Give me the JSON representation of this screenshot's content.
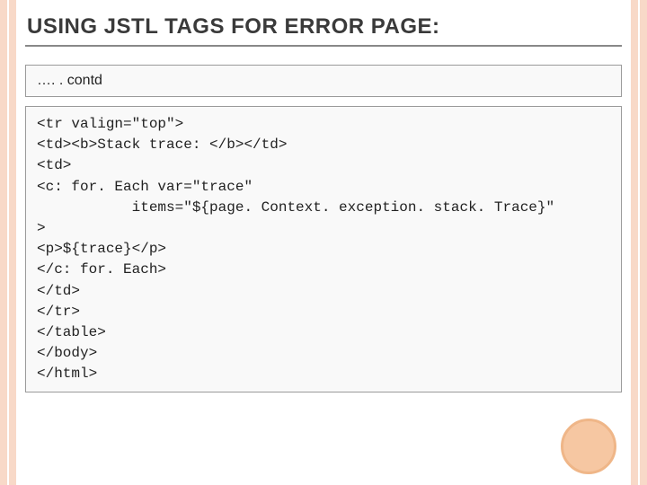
{
  "title": "USING JSTL TAGS FOR ERROR PAGE:",
  "contd_label": "…. . contd",
  "code_lines": [
    "<tr valign=\"top\">",
    "<td><b>Stack trace: </b></td>",
    "<td>",
    "<c: for. Each var=\"trace\"",
    "           items=\"${page. Context. exception. stack. Trace}\"",
    ">",
    "<p>${trace}</p>",
    "</c: for. Each>",
    "</td>",
    "</tr>",
    "</table>",
    "</body>",
    "</html>"
  ]
}
